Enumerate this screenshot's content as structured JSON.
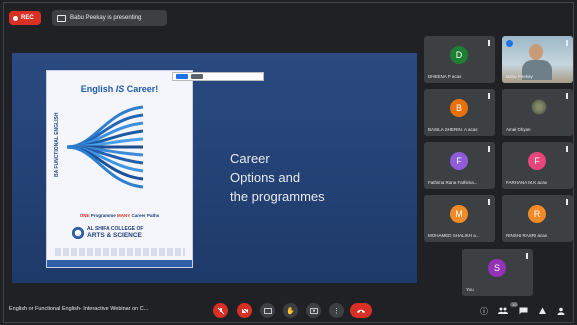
{
  "top": {
    "rec_label": "REC",
    "presenting_text": "Babu Peekay is presenting"
  },
  "slide": {
    "poster_title_a": "English ",
    "poster_title_b": "IS",
    "poster_title_c": " Career!",
    "poster_side_text": "BA FUNCTIONAL ENGLISH",
    "poster_tag_a": "ONE",
    "poster_tag_b": " Programme ",
    "poster_tag_c": "MANY",
    "poster_tag_d": " Career Paths",
    "college_line1": "AL SHIFA COLLEGE OF",
    "college_line2": "ARTS & SCIENCE",
    "text_line1": "Career",
    "text_line2": "Options and",
    "text_line3": "the programmes"
  },
  "participants": [
    {
      "name": "DHEENA P acas",
      "initial": "D",
      "color": "#1e7e34"
    },
    {
      "name": "Babu Peekay",
      "initial": "",
      "color": ""
    },
    {
      "name": "BASILA SHERIN. A acas",
      "initial": "B",
      "color": "#e8710a"
    },
    {
      "name": "Amal Dhyan",
      "initial": "",
      "color": ""
    },
    {
      "name": "Fathima Rana Fathima...",
      "initial": "F",
      "color": "#8e5cd9"
    },
    {
      "name": "FARHANA M.K acas",
      "initial": "F",
      "color": "#e8457a"
    },
    {
      "name": "MOHAMED SHALIKH a...",
      "initial": "M",
      "color": "#f28b26"
    },
    {
      "name": "RINSHI RASRI acas",
      "initial": "R",
      "color": "#f28b26"
    },
    {
      "name": "You",
      "initial": "S",
      "color": "#9334b6"
    }
  ],
  "bottom": {
    "meeting_title": "English or Functional English- Interactive Webinar on C...",
    "participant_count": "10"
  },
  "colors": {
    "rec_red": "#d93025",
    "background": "#202124",
    "tile": "#3c4043",
    "accent": "#1a73e8"
  }
}
